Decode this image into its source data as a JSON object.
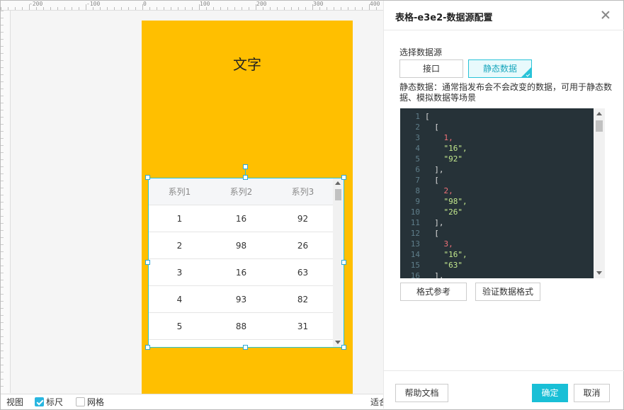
{
  "ruler": {
    "top_ticks": [
      "-200",
      "-100",
      "0",
      "100",
      "200",
      "300",
      "400"
    ]
  },
  "canvas": {
    "text": "文字",
    "background": "#ffbf00"
  },
  "table": {
    "headers": [
      "系列1",
      "系列2",
      "系列3"
    ],
    "rows": [
      [
        "1",
        "16",
        "92"
      ],
      [
        "2",
        "98",
        "26"
      ],
      [
        "3",
        "16",
        "63"
      ],
      [
        "4",
        "93",
        "82"
      ],
      [
        "5",
        "88",
        "31"
      ]
    ]
  },
  "bottom_bar": {
    "view_label": "视图",
    "ruler_label": "标尺",
    "ruler_checked": true,
    "grid_label": "网格",
    "grid_checked": false,
    "fit_label": "适合"
  },
  "panel": {
    "title": "表格-e3e2-数据源配置",
    "source_label": "选择数据源",
    "source_options": [
      "接口",
      "静态数据"
    ],
    "selected_source": "静态数据",
    "description": "静态数据：通常指发布会不会改变的数据，可用于静态数据、模拟数据等场景",
    "code_lines": [
      {
        "n": "1",
        "text": "[",
        "kind": "p"
      },
      {
        "n": "2",
        "text": "  [",
        "kind": "p"
      },
      {
        "n": "3",
        "text": "    1,",
        "kind": "num"
      },
      {
        "n": "4",
        "text": "    \"16\",",
        "kind": "str"
      },
      {
        "n": "5",
        "text": "    \"92\"",
        "kind": "str"
      },
      {
        "n": "6",
        "text": "  ],",
        "kind": "p"
      },
      {
        "n": "7",
        "text": "  [",
        "kind": "p"
      },
      {
        "n": "8",
        "text": "    2,",
        "kind": "num"
      },
      {
        "n": "9",
        "text": "    \"98\",",
        "kind": "str"
      },
      {
        "n": "10",
        "text": "    \"26\"",
        "kind": "str"
      },
      {
        "n": "11",
        "text": "  ],",
        "kind": "p"
      },
      {
        "n": "12",
        "text": "  [",
        "kind": "p"
      },
      {
        "n": "13",
        "text": "    3,",
        "kind": "num"
      },
      {
        "n": "14",
        "text": "    \"16\",",
        "kind": "str"
      },
      {
        "n": "15",
        "text": "    \"63\"",
        "kind": "str"
      },
      {
        "n": "16",
        "text": "  ],",
        "kind": "p"
      }
    ],
    "format_ref_label": "格式参考",
    "validate_label": "验证数据格式",
    "help_label": "帮助文档",
    "ok_label": "确定",
    "cancel_label": "取消",
    "accent": "#19bfd6"
  }
}
